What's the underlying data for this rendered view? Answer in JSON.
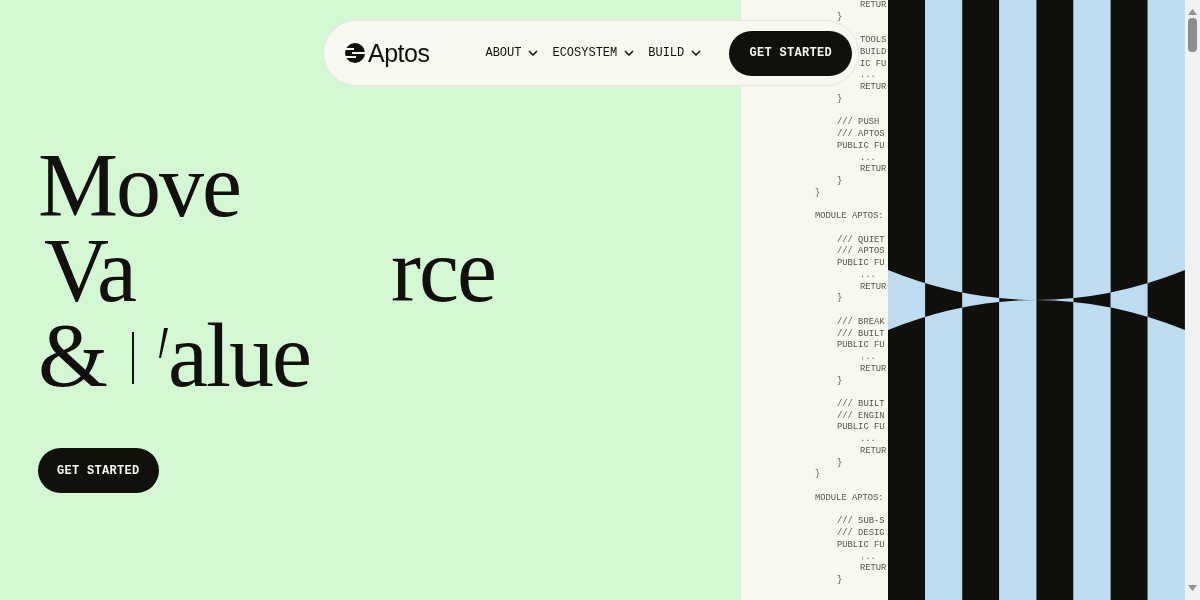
{
  "nav": {
    "logo_text": "Aptos",
    "items": [
      {
        "label": "ABOUT"
      },
      {
        "label": "ECOSYSTEM"
      },
      {
        "label": "BUILD"
      }
    ],
    "cta": "GET STARTED"
  },
  "hero": {
    "lines": [
      {
        "kind": "plain",
        "fragments": [
          "Move"
        ]
      },
      {
        "kind": "split",
        "fragments": [
          "Va",
          "rce"
        ]
      },
      {
        "kind": "cursor",
        "fragments": [
          "&",
          "alue"
        ]
      }
    ],
    "button": "GET STARTED"
  },
  "code": [
    {
      "lines": [
        {
          "text": "RETUR",
          "kind": "body"
        },
        {
          "text": "}",
          "kind": "member"
        }
      ]
    },
    {
      "lines": [
        {
          "text": "TOOLS",
          "kind": "body"
        },
        {
          "text": "BUILD",
          "kind": "body"
        },
        {
          "text": "IC FU",
          "kind": "body"
        },
        {
          "text": "...",
          "kind": "body"
        },
        {
          "text": "RETUR",
          "kind": "body"
        },
        {
          "text": "}",
          "kind": "member"
        }
      ]
    },
    {
      "lines": [
        {
          "text": "/// PUSH",
          "kind": "member"
        },
        {
          "text": "/// APTOS",
          "kind": "member"
        },
        {
          "text": "PUBLIC FU",
          "kind": "member"
        },
        {
          "text": "...",
          "kind": "body"
        },
        {
          "text": "RETUR",
          "kind": "body"
        },
        {
          "text": "}",
          "kind": "member"
        },
        {
          "text": "}",
          "kind": "top"
        }
      ]
    },
    {
      "lines": [
        {
          "text": "MODULE APTOS:",
          "kind": "top"
        }
      ]
    },
    {
      "lines": [
        {
          "text": "/// QUIET",
          "kind": "member"
        },
        {
          "text": "/// APTOS",
          "kind": "member"
        },
        {
          "text": "PUBLIC FU",
          "kind": "member"
        },
        {
          "text": "...",
          "kind": "body"
        },
        {
          "text": "RETUR",
          "kind": "body"
        },
        {
          "text": "}",
          "kind": "member"
        }
      ]
    },
    {
      "lines": [
        {
          "text": "/// BREAK",
          "kind": "member"
        },
        {
          "text": "/// BUILT",
          "kind": "member"
        },
        {
          "text": "PUBLIC FU",
          "kind": "member"
        },
        {
          "text": "...",
          "kind": "body"
        },
        {
          "text": "RETUR",
          "kind": "body"
        },
        {
          "text": "}",
          "kind": "member"
        }
      ]
    },
    {
      "lines": [
        {
          "text": "/// BUILT",
          "kind": "member"
        },
        {
          "text": "/// ENGIN",
          "kind": "member"
        },
        {
          "text": "PUBLIC FU",
          "kind": "member"
        },
        {
          "text": "...",
          "kind": "body"
        },
        {
          "text": "RETUR",
          "kind": "body"
        },
        {
          "text": "}",
          "kind": "member"
        },
        {
          "text": "}",
          "kind": "top"
        }
      ]
    },
    {
      "lines": [
        {
          "text": "MODULE APTOS:",
          "kind": "top"
        }
      ]
    },
    {
      "lines": [
        {
          "text": "/// SUB-S",
          "kind": "member"
        },
        {
          "text": "/// DESIG",
          "kind": "member"
        },
        {
          "text": "PUBLIC FU",
          "kind": "member"
        },
        {
          "text": "...",
          "kind": "body"
        },
        {
          "text": "RETUR",
          "kind": "body"
        },
        {
          "text": "}",
          "kind": "member"
        }
      ]
    }
  ]
}
